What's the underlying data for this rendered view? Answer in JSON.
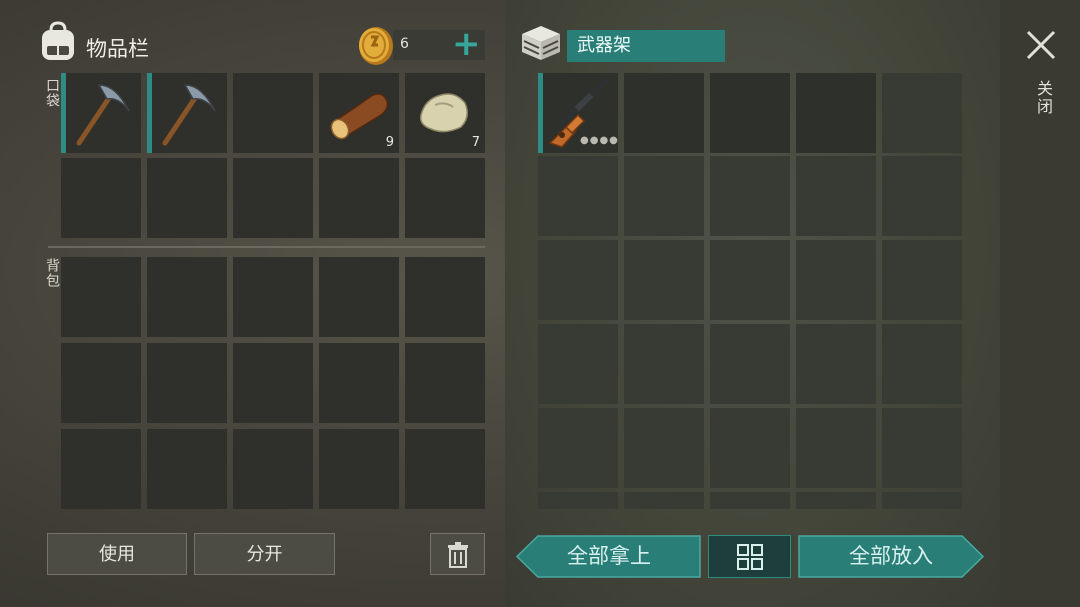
{
  "inventory": {
    "title": "物品栏",
    "coins": "6",
    "add_icon": "plus-icon",
    "pocket_label": "口袋",
    "bag_label": "背包",
    "pocket_items": [
      {
        "name": "pickaxe",
        "qty": ""
      },
      {
        "name": "pickaxe",
        "qty": ""
      },
      {
        "name": "",
        "qty": ""
      },
      {
        "name": "wood-log",
        "qty": "9"
      },
      {
        "name": "stone",
        "qty": "7"
      }
    ]
  },
  "container": {
    "title": "武器架",
    "items": [
      {
        "name": "rifle",
        "durability_dots": "●●●●"
      }
    ]
  },
  "close": {
    "label": "关闭"
  },
  "buttons": {
    "use": "使用",
    "split": "分开",
    "take_all": "全部拿上",
    "put_all": "全部放入"
  },
  "colors": {
    "accent": "#2d8c84",
    "teal_button": "#2a7e78"
  }
}
